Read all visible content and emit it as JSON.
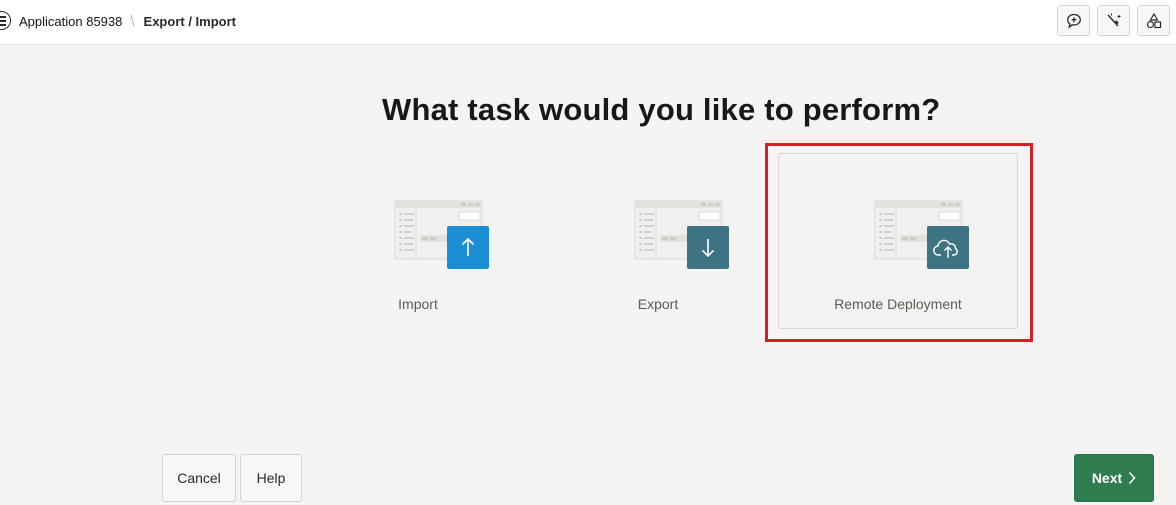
{
  "header": {
    "breadcrumb": {
      "app_link": "Application 85938",
      "separator": "\\",
      "current": "Export / Import"
    },
    "tools": [
      {
        "icon": "feedback-icon"
      },
      {
        "icon": "magic-wand-icon"
      },
      {
        "icon": "shapes-icon"
      }
    ]
  },
  "main": {
    "title": "What task would you like to perform?",
    "options": [
      {
        "label": "Import",
        "icon": "upload-arrow-icon",
        "color": "#1b8ed6",
        "selected": false
      },
      {
        "label": "Export",
        "icon": "download-arrow-icon",
        "color": "#3e7383",
        "selected": false
      },
      {
        "label": "Remote Deployment",
        "icon": "cloud-upload-icon",
        "color": "#3e7383",
        "selected": true
      }
    ]
  },
  "footer": {
    "cancel_label": "Cancel",
    "help_label": "Help",
    "next_label": "Next",
    "next_color": "#2f7d4f"
  },
  "annotation": {
    "highlight_color": "#d91f26"
  }
}
